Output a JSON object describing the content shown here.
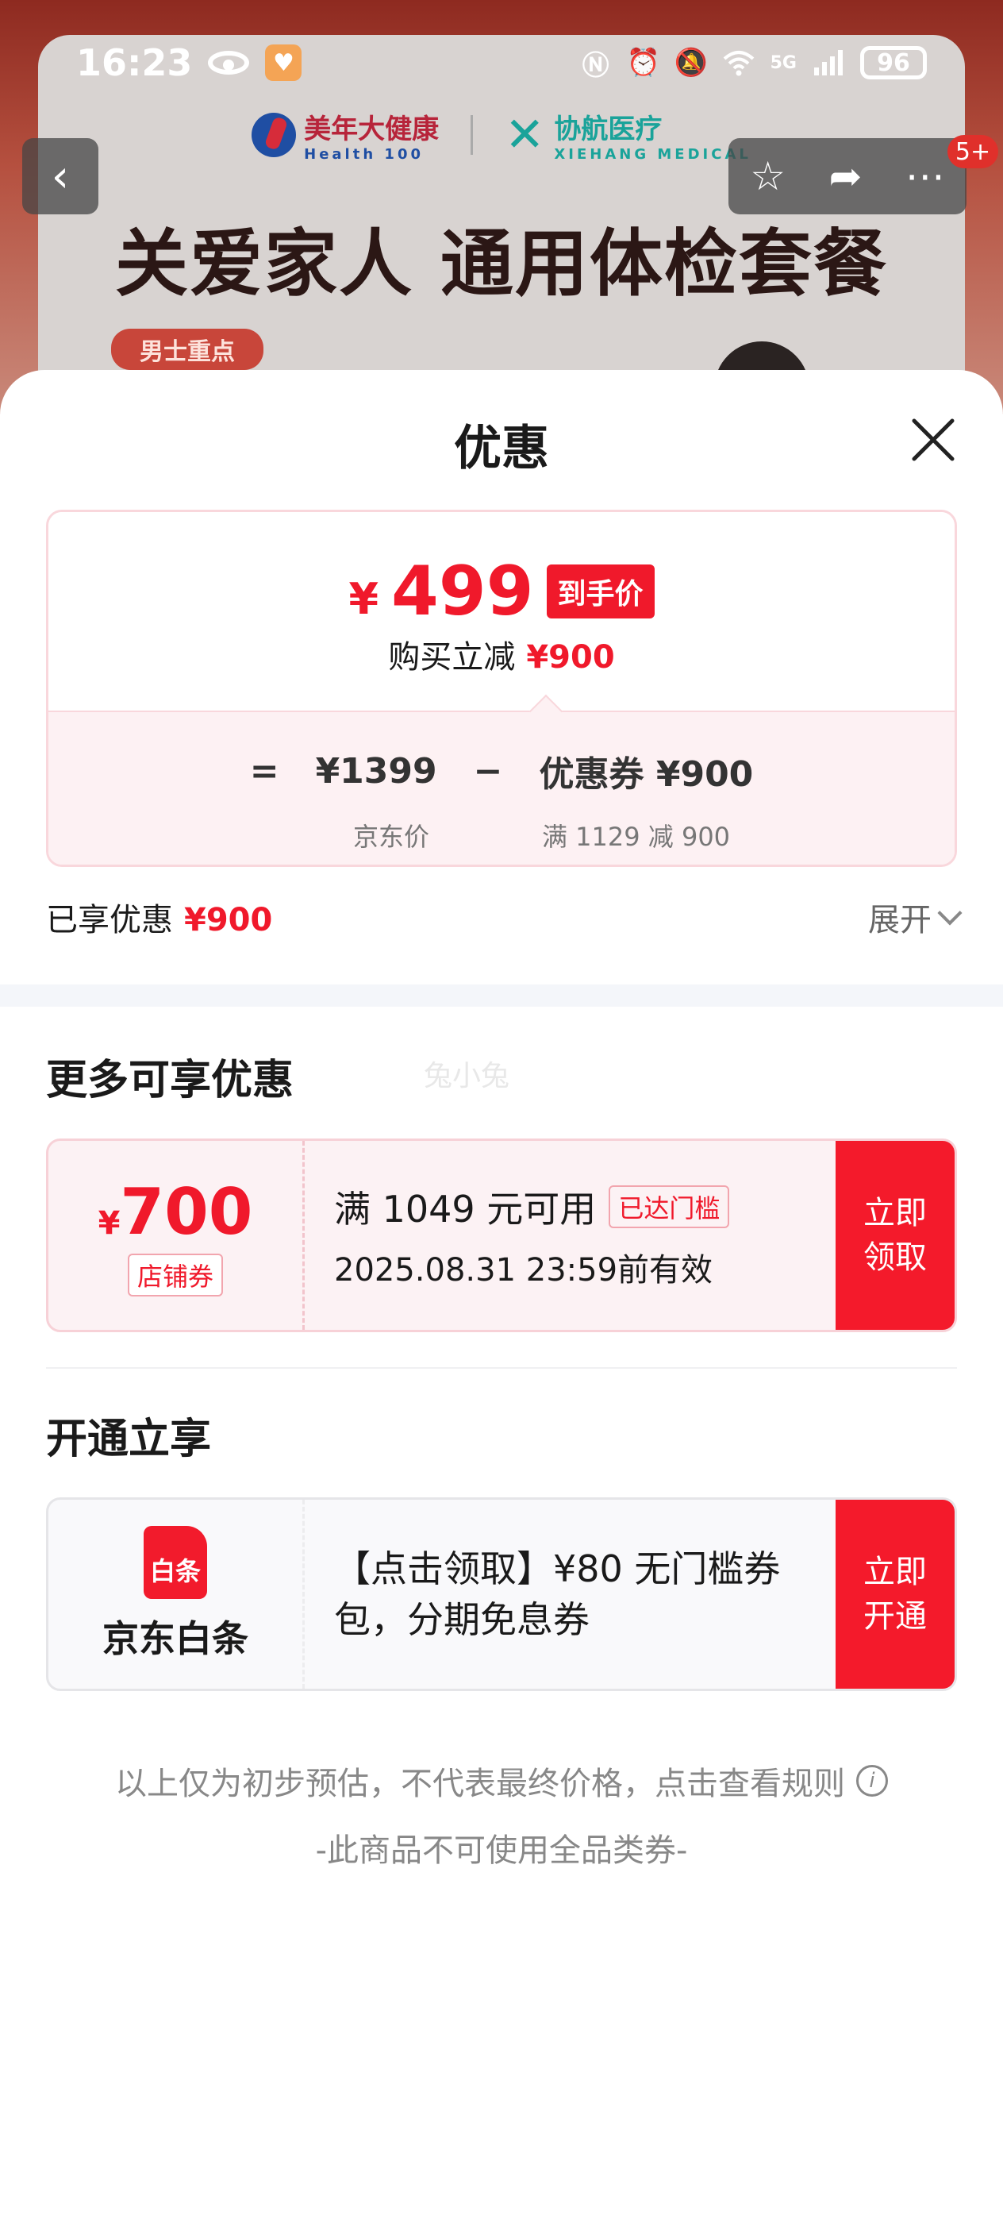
{
  "status_bar": {
    "time": "16:23",
    "signal": "5G",
    "battery": "96"
  },
  "background": {
    "logo_left_cn": "美年大健康",
    "logo_left_en": "Health 100",
    "logo_right_cn": "协航医疗",
    "logo_right_en": "XIEHANG MEDICAL",
    "banner_title": "关爱家人 通用体检套餐",
    "banner_tag": "男士重点",
    "nav_badge": "5+"
  },
  "sheet": {
    "title": "优惠",
    "final_price": {
      "currency": "¥",
      "amount": "499",
      "tag": "到手价",
      "reduce_label": "购买立减",
      "reduce_amount": "¥900"
    },
    "calc": {
      "equals": "=",
      "jd_price": "¥1399",
      "minus": "−",
      "coupon": "优惠券 ¥900",
      "jd_price_label": "京东价",
      "coupon_rule": "满 1129 减 900"
    },
    "enjoyed": {
      "label": "已享优惠",
      "amount": "¥900"
    },
    "expand_label": "展开",
    "more_section_title": "更多可享优惠",
    "watermark": "兔小兔",
    "store_coupon": {
      "currency": "¥",
      "amount": "700",
      "type": "店铺券",
      "condition": "满 1049 元可用",
      "reached_tag": "已达门槛",
      "validity": "2025.08.31 23:59前有效",
      "button_line1": "立即",
      "button_line2": "领取"
    },
    "open_section_title": "开通立享",
    "baitiao": {
      "icon_text": "白条",
      "name": "京东白条",
      "desc_line1": "【点击领取】¥80 无门槛券",
      "desc_line2": "包，分期免息券",
      "button_line1": "立即",
      "button_line2": "开通"
    },
    "footer_note": "以上仅为初步预估，不代表最终价格，点击查看规则",
    "footer_note2": "-此商品不可使用全品类券-"
  }
}
